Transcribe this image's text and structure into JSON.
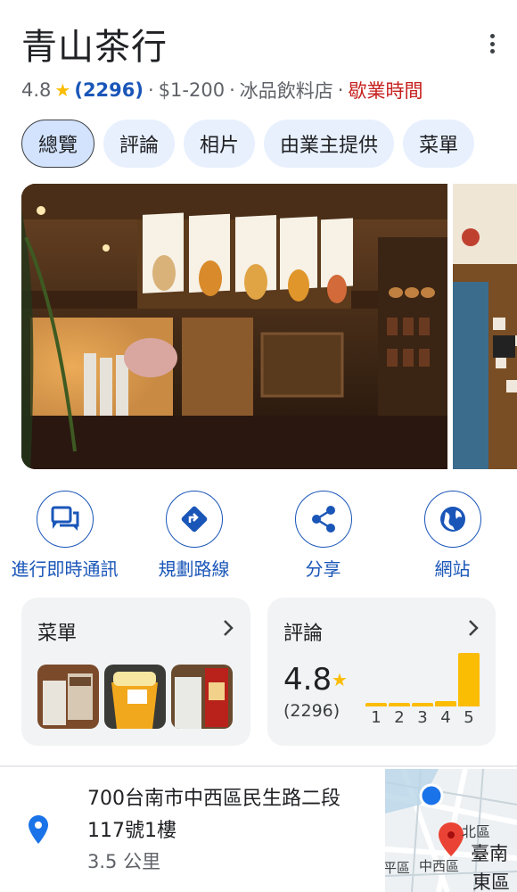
{
  "place": {
    "name": "青山茶行",
    "rating": "4.8",
    "review_count": "(2296)",
    "price": "$1-200",
    "category": "冰品飲料店",
    "hours_status": "歇業時間",
    "separator": "·"
  },
  "tabs": [
    {
      "label": "總覽",
      "active": true
    },
    {
      "label": "評論"
    },
    {
      "label": "相片"
    },
    {
      "label": "由業主提供"
    },
    {
      "label": "菜單"
    }
  ],
  "actions": [
    {
      "label": "進行即時通訊",
      "icon": "chat-icon"
    },
    {
      "label": "規劃路線",
      "icon": "directions-icon"
    },
    {
      "label": "分享",
      "icon": "share-icon"
    },
    {
      "label": "網站",
      "icon": "globe-icon"
    }
  ],
  "menu_card": {
    "title": "菜單"
  },
  "reviews_card": {
    "title": "評論",
    "rating": "4.8",
    "count": "(2296)",
    "distribution": [
      {
        "stars": "1",
        "share": 0.04
      },
      {
        "stars": "2",
        "share": 0.03
      },
      {
        "stars": "3",
        "share": 0.04
      },
      {
        "stars": "4",
        "share": 0.08
      },
      {
        "stars": "5",
        "share": 0.81
      }
    ]
  },
  "address": {
    "line": "700台南市中西區民生路二段117號1樓",
    "distance": "3.5 公里"
  },
  "map": {
    "labels": [
      "北區",
      "臺南",
      "東區",
      "平區",
      "中西區"
    ]
  },
  "colors": {
    "accent": "#1a56b8",
    "star": "#fbbc04",
    "closed": "#c5221f",
    "chip": "#e8f0fe"
  }
}
